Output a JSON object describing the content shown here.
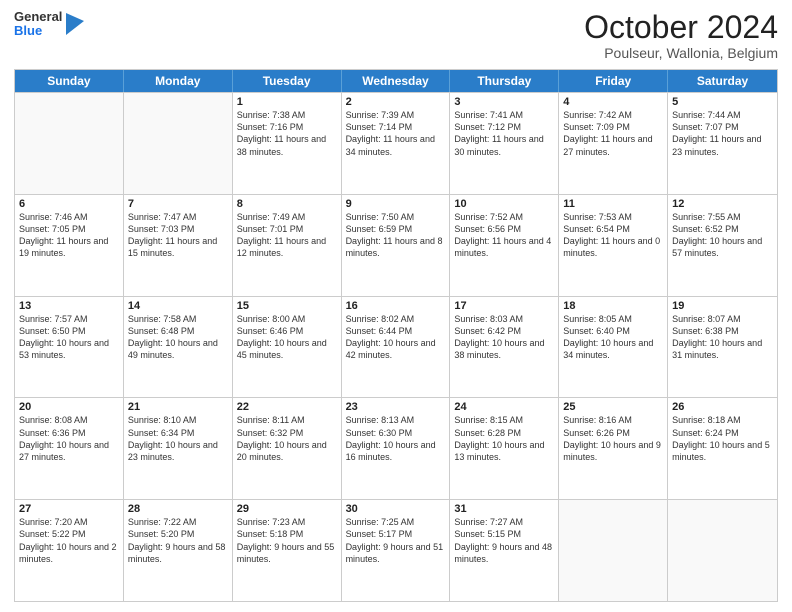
{
  "header": {
    "logo": {
      "line1": "General",
      "line2": "Blue"
    },
    "title": "October 2024",
    "subtitle": "Poulseur, Wallonia, Belgium"
  },
  "calendar": {
    "days_of_week": [
      "Sunday",
      "Monday",
      "Tuesday",
      "Wednesday",
      "Thursday",
      "Friday",
      "Saturday"
    ],
    "rows": [
      [
        {
          "day": "",
          "empty": true,
          "info": ""
        },
        {
          "day": "",
          "empty": true,
          "info": ""
        },
        {
          "day": "1",
          "info": "Sunrise: 7:38 AM\nSunset: 7:16 PM\nDaylight: 11 hours and 38 minutes."
        },
        {
          "day": "2",
          "info": "Sunrise: 7:39 AM\nSunset: 7:14 PM\nDaylight: 11 hours and 34 minutes."
        },
        {
          "day": "3",
          "info": "Sunrise: 7:41 AM\nSunset: 7:12 PM\nDaylight: 11 hours and 30 minutes."
        },
        {
          "day": "4",
          "info": "Sunrise: 7:42 AM\nSunset: 7:09 PM\nDaylight: 11 hours and 27 minutes."
        },
        {
          "day": "5",
          "info": "Sunrise: 7:44 AM\nSunset: 7:07 PM\nDaylight: 11 hours and 23 minutes."
        }
      ],
      [
        {
          "day": "6",
          "info": "Sunrise: 7:46 AM\nSunset: 7:05 PM\nDaylight: 11 hours and 19 minutes."
        },
        {
          "day": "7",
          "info": "Sunrise: 7:47 AM\nSunset: 7:03 PM\nDaylight: 11 hours and 15 minutes."
        },
        {
          "day": "8",
          "info": "Sunrise: 7:49 AM\nSunset: 7:01 PM\nDaylight: 11 hours and 12 minutes."
        },
        {
          "day": "9",
          "info": "Sunrise: 7:50 AM\nSunset: 6:59 PM\nDaylight: 11 hours and 8 minutes."
        },
        {
          "day": "10",
          "info": "Sunrise: 7:52 AM\nSunset: 6:56 PM\nDaylight: 11 hours and 4 minutes."
        },
        {
          "day": "11",
          "info": "Sunrise: 7:53 AM\nSunset: 6:54 PM\nDaylight: 11 hours and 0 minutes."
        },
        {
          "day": "12",
          "info": "Sunrise: 7:55 AM\nSunset: 6:52 PM\nDaylight: 10 hours and 57 minutes."
        }
      ],
      [
        {
          "day": "13",
          "info": "Sunrise: 7:57 AM\nSunset: 6:50 PM\nDaylight: 10 hours and 53 minutes."
        },
        {
          "day": "14",
          "info": "Sunrise: 7:58 AM\nSunset: 6:48 PM\nDaylight: 10 hours and 49 minutes."
        },
        {
          "day": "15",
          "info": "Sunrise: 8:00 AM\nSunset: 6:46 PM\nDaylight: 10 hours and 45 minutes."
        },
        {
          "day": "16",
          "info": "Sunrise: 8:02 AM\nSunset: 6:44 PM\nDaylight: 10 hours and 42 minutes."
        },
        {
          "day": "17",
          "info": "Sunrise: 8:03 AM\nSunset: 6:42 PM\nDaylight: 10 hours and 38 minutes."
        },
        {
          "day": "18",
          "info": "Sunrise: 8:05 AM\nSunset: 6:40 PM\nDaylight: 10 hours and 34 minutes."
        },
        {
          "day": "19",
          "info": "Sunrise: 8:07 AM\nSunset: 6:38 PM\nDaylight: 10 hours and 31 minutes."
        }
      ],
      [
        {
          "day": "20",
          "info": "Sunrise: 8:08 AM\nSunset: 6:36 PM\nDaylight: 10 hours and 27 minutes."
        },
        {
          "day": "21",
          "info": "Sunrise: 8:10 AM\nSunset: 6:34 PM\nDaylight: 10 hours and 23 minutes."
        },
        {
          "day": "22",
          "info": "Sunrise: 8:11 AM\nSunset: 6:32 PM\nDaylight: 10 hours and 20 minutes."
        },
        {
          "day": "23",
          "info": "Sunrise: 8:13 AM\nSunset: 6:30 PM\nDaylight: 10 hours and 16 minutes."
        },
        {
          "day": "24",
          "info": "Sunrise: 8:15 AM\nSunset: 6:28 PM\nDaylight: 10 hours and 13 minutes."
        },
        {
          "day": "25",
          "info": "Sunrise: 8:16 AM\nSunset: 6:26 PM\nDaylight: 10 hours and 9 minutes."
        },
        {
          "day": "26",
          "info": "Sunrise: 8:18 AM\nSunset: 6:24 PM\nDaylight: 10 hours and 5 minutes."
        }
      ],
      [
        {
          "day": "27",
          "info": "Sunrise: 7:20 AM\nSunset: 5:22 PM\nDaylight: 10 hours and 2 minutes."
        },
        {
          "day": "28",
          "info": "Sunrise: 7:22 AM\nSunset: 5:20 PM\nDaylight: 9 hours and 58 minutes."
        },
        {
          "day": "29",
          "info": "Sunrise: 7:23 AM\nSunset: 5:18 PM\nDaylight: 9 hours and 55 minutes."
        },
        {
          "day": "30",
          "info": "Sunrise: 7:25 AM\nSunset: 5:17 PM\nDaylight: 9 hours and 51 minutes."
        },
        {
          "day": "31",
          "info": "Sunrise: 7:27 AM\nSunset: 5:15 PM\nDaylight: 9 hours and 48 minutes."
        },
        {
          "day": "",
          "empty": true,
          "info": ""
        },
        {
          "day": "",
          "empty": true,
          "info": ""
        }
      ]
    ]
  }
}
